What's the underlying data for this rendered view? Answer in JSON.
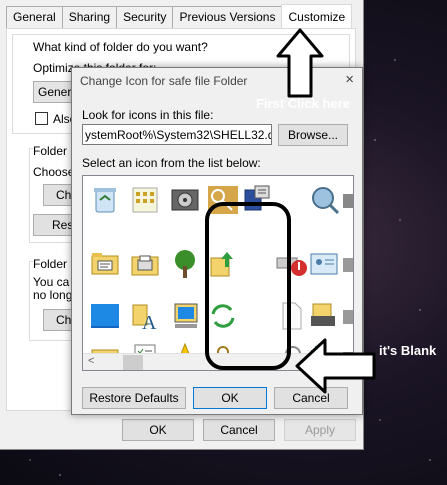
{
  "properties_window": {
    "tabs": [
      {
        "label": "General",
        "active": false
      },
      {
        "label": "Sharing",
        "active": false
      },
      {
        "label": "Security",
        "active": false
      },
      {
        "label": "Previous Versions",
        "active": false
      },
      {
        "label": "Customize",
        "active": true
      }
    ],
    "folder_type_question": "What kind of folder do you want?",
    "optimize_label": "Optimize this folder for:",
    "optimize_value": "Genera",
    "also_apply_label": "Also",
    "folder_pictures_group": "Folder p",
    "choose_label": "Choose",
    "choose_file_button": "Cho",
    "restore_default_button": "Resto",
    "folder_icons_group": "Folder ic",
    "folder_icons_text_1": "You ca",
    "folder_icons_text_2": "no longe",
    "change_icon_button": "Chan",
    "ok_button": "OK",
    "cancel_button": "Cancel",
    "apply_button": "Apply"
  },
  "change_icon_dialog": {
    "title": "Change Icon for safe file Folder",
    "close_glyph": "×",
    "look_for_label": "Look for icons in this file:",
    "path_value": "ystemRoot%\\System32\\SHELL32.dll",
    "browse_button": "Browse...",
    "select_label": "Select an icon from the list below:",
    "scroll_left_glyph": "<",
    "restore_defaults_button": "Restore Defaults",
    "ok_button": "OK",
    "cancel_button": "Cancel",
    "icons": [
      "recycle-bin-icon",
      "window-grid-icon",
      "media-drive-icon",
      "key-icon",
      "computer-network-icon",
      "",
      "folder-tasks-icon",
      "printer-folder-icon",
      "tree-icon",
      "folder-upload-icon",
      "",
      "",
      "monitor-icon",
      "folder-font-icon",
      "computer-icon",
      "",
      "",
      "",
      "tools-folder-icon",
      "checklist-icon",
      "star-icon",
      "",
      "",
      ""
    ],
    "right_col_icons": [
      "magnifier-computer-icon",
      "drive-error-icon",
      "blank-page-icon",
      "search-page-icon"
    ],
    "far_right_icons": [
      "network-card-icon",
      "printer-icon",
      "printer-stack-icon",
      "printer-add-icon"
    ]
  },
  "annotations": {
    "first_click": "First Click here",
    "its_blank": "it's Blank"
  },
  "colors": {
    "highlight": "#000000",
    "annotation_text": "#ffffff",
    "primary_border": "#0078d7"
  }
}
